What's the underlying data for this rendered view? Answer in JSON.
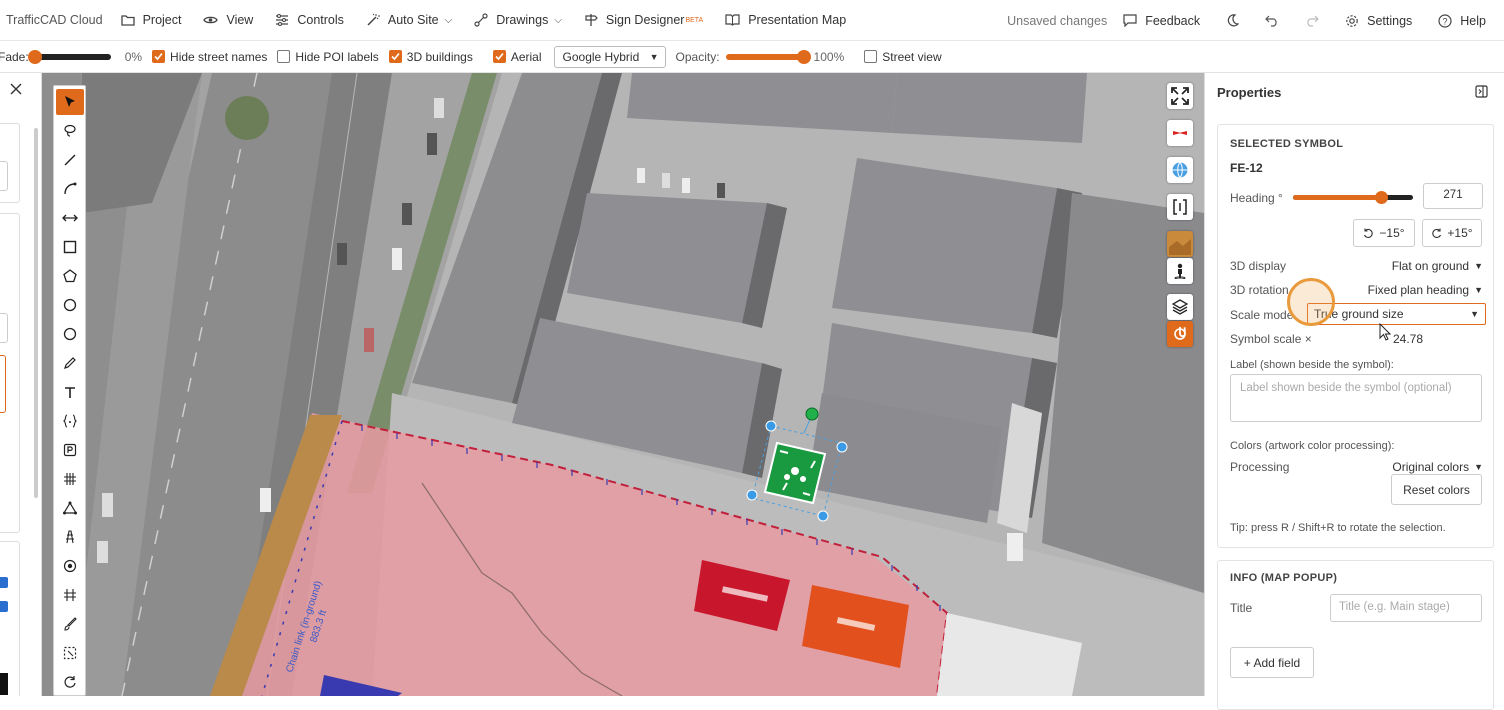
{
  "app": {
    "brand": "TrafficCAD Cloud",
    "menus": [
      {
        "label": "Project"
      },
      {
        "label": "View"
      },
      {
        "label": "Controls"
      },
      {
        "label": "Auto Site"
      },
      {
        "label": "Drawings"
      },
      {
        "label": "Sign Designer",
        "badge": "BETA"
      },
      {
        "label": "Presentation Map"
      }
    ],
    "status": "Unsaved changes",
    "feedback": "Feedback",
    "settings": "Settings",
    "help": "Help"
  },
  "options": {
    "fade_label": "Fade:",
    "fade_value": "0%",
    "fade_level": 0,
    "hide_street_names": "Hide street names",
    "hide_poi_labels": "Hide POI labels",
    "buildings_3d": "3D buildings",
    "aerial": "Aerial",
    "provider": "Google Hybrid",
    "opacity_label": "Opacity:",
    "opacity_value": "100%",
    "opacity_level": 1,
    "street_view": "Street view"
  },
  "map": {
    "fence_label": "Chain link (in-ground)",
    "fence_length": "883.3 ft",
    "accent": "#e06a1b"
  },
  "properties": {
    "title": "Properties",
    "section_selected": "SELECTED SYMBOL",
    "symbol_id": "FE-12",
    "heading_label": "Heading °",
    "heading_value": "271",
    "rot_minus": "−15°",
    "rot_plus": "+15°",
    "display_label": "3D display",
    "display_value": "Flat on ground",
    "rotation_label": "3D rotation",
    "rotation_value": "Fixed plan heading",
    "scale_mode_label": "Scale mode",
    "scale_mode_value": "True ground size",
    "symbol_scale_label": "Symbol scale ×",
    "symbol_scale_value": "24.78",
    "label_title": "Label (shown beside the symbol):",
    "label_placeholder": "Label shown beside the symbol (optional)",
    "colors_title": "Colors (artwork color processing):",
    "processing_label": "Processing",
    "processing_value": "Original colors",
    "reset_colors": "Reset colors",
    "tip": "Tip: press R / Shift+R to rotate the selection.",
    "section_info": "INFO (MAP POPUP)",
    "info_title_label": "Title",
    "info_title_placeholder": "Title (e.g. Main stage)",
    "add_field": "+ Add field"
  }
}
